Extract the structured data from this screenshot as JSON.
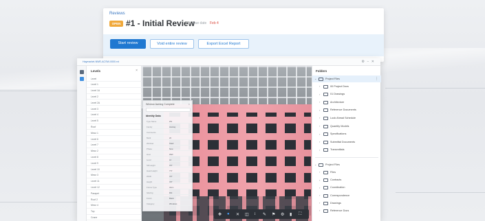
{
  "review": {
    "breadcrumb": "Reviews",
    "status_badge": "OPEN",
    "title": "#1 - Initial Review",
    "due_label": "Due date",
    "due_value": "Feb 4",
    "buttons": {
      "start": "Start review",
      "void": "Void entire review",
      "export": "Export Excel Report"
    },
    "colors": {
      "primary": "#1f78d1",
      "badge": "#f0a93c",
      "due": "#d9473b"
    }
  },
  "viewer": {
    "file_name": "Haymarket-NWE-ACSW-0000.rvt",
    "window_controls": "⚙ − ✕",
    "levels": {
      "header": "Levels",
      "items": [
        "Level",
        "Level 1",
        "Level 1A",
        "Level 2",
        "Level 2A",
        "Level 3",
        "Level 4",
        "Level 5",
        "Roof",
        "Mezz 1",
        "Level 6",
        "Level 7",
        "Mezz 2",
        "Level 8",
        "Level 9",
        "Level 10",
        "Mezz 3",
        "Level 11",
        "Level 12",
        "Parapet",
        "Roof 2",
        "Mezz 4",
        "Top",
        "Crane"
      ]
    },
    "properties": {
      "title": "Window Awning Complete",
      "section": "Identity Data",
      "rows": [
        {
          "key": "Type Name",
          "value": "W1"
        },
        {
          "key": "Family",
          "value": "Awning"
        },
        {
          "key": "Comments",
          "value": ""
        },
        {
          "key": "Mark",
          "value": "22"
        },
        {
          "key": "Workset",
          "value": "Shell"
        },
        {
          "key": "Phase",
          "value": "New"
        },
        {
          "key": "Host",
          "value": "Wall"
        },
        {
          "key": "Level",
          "value": "L2"
        },
        {
          "key": "Sill Height",
          "value": "3'0\""
        },
        {
          "key": "Head Height",
          "value": "7'0\""
        },
        {
          "key": "Width",
          "value": "4'0\""
        },
        {
          "key": "Height",
          "value": "4'0\""
        },
        {
          "key": "Frame Type",
          "value": "Alum"
        },
        {
          "key": "Glazing",
          "value": "Dbl"
        },
        {
          "key": "Finish",
          "value": "Black"
        },
        {
          "key": "Category",
          "value": "Windows"
        }
      ]
    },
    "toolbar_tools": [
      {
        "icon": "orbit-icon",
        "glyph": "✥"
      },
      {
        "icon": "pan-icon",
        "glyph": "●"
      },
      {
        "icon": "measure-icon",
        "glyph": "✕"
      },
      {
        "icon": "section-icon",
        "glyph": "◫"
      },
      {
        "icon": "explode-icon",
        "glyph": "↕"
      },
      {
        "icon": "markup-icon",
        "glyph": "✎"
      },
      {
        "icon": "model-browser-icon",
        "glyph": "⚑"
      },
      {
        "icon": "properties-icon",
        "glyph": "⚙"
      },
      {
        "icon": "settings-icon",
        "glyph": "▮"
      },
      {
        "icon": "fullscreen-icon",
        "glyph": "⛶"
      }
    ]
  },
  "folders": {
    "header": "Folders",
    "project_files": {
      "label": "Project Files",
      "items": [
        "00 Project Docs",
        "01 Drawings",
        "Architecture",
        "Reference Documents",
        "Look Ahead Schedule",
        "Quantity Models",
        "Specifications",
        "Submittal Documents",
        "Transmittals"
      ]
    },
    "plans": {
      "label": "Project Files",
      "items": [
        "Files",
        "Contracts",
        "Coordination",
        "Correspondence",
        "Drawings",
        "Reference Docs"
      ]
    }
  }
}
